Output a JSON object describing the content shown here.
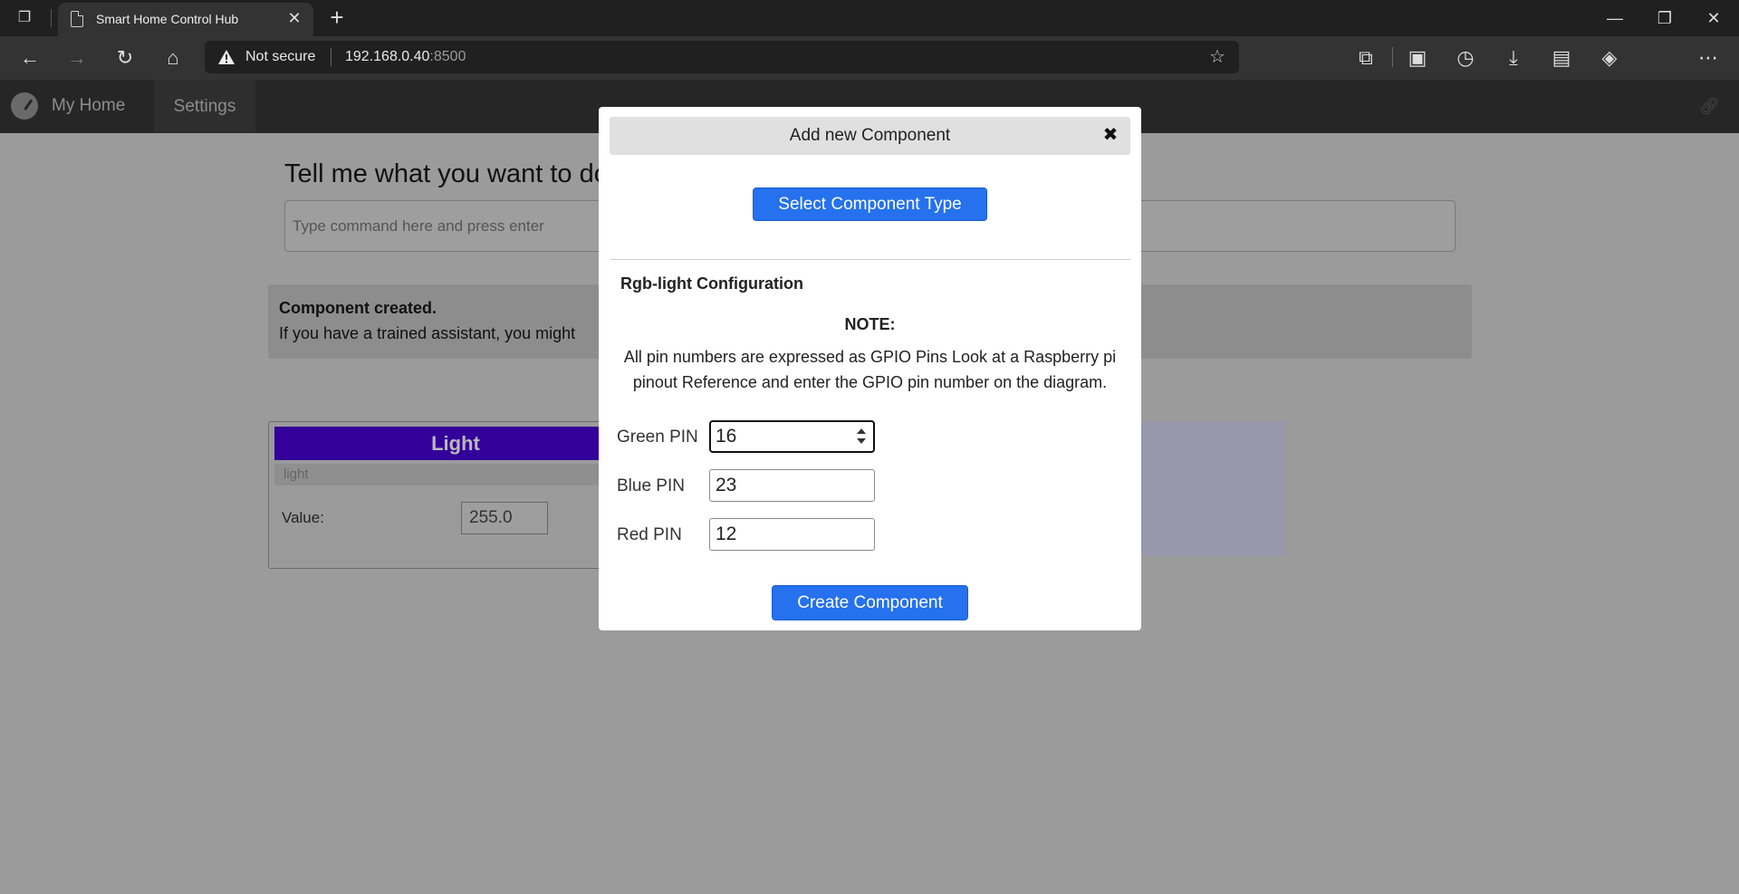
{
  "browser": {
    "tab_title": "Smart Home Control Hub",
    "security_label": "Not secure",
    "url_host": "192.168.0.40",
    "url_port": ":8500"
  },
  "header": {
    "home_label": "My Home",
    "settings_label": "Settings"
  },
  "page": {
    "title": "Tell me what you want to do",
    "command_placeholder": "Type command here and press enter",
    "notice_title": "Component created.",
    "notice_text": "If you have a trained assistant, you might"
  },
  "card": {
    "title": "Light",
    "subtitle": "light",
    "value_label": "Value:",
    "value": "255.0"
  },
  "modal": {
    "title": "Add new Component",
    "select_button": "Select Component Type",
    "config_title": "Rgb-light Configuration",
    "note_title": "NOTE:",
    "note_text": "All pin numbers are expressed as GPIO Pins Look at a Raspberry pi pinout Reference and enter the GPIO pin number on the diagram.",
    "fields": [
      {
        "label": "Green PIN",
        "value": "16"
      },
      {
        "label": "Blue PIN",
        "value": "23"
      },
      {
        "label": "Red PIN",
        "value": "12"
      }
    ],
    "create_button": "Create Component"
  },
  "colors": {
    "primary": "#2571ee",
    "card_header": "#330099",
    "overlay": "#9b9b9b"
  }
}
